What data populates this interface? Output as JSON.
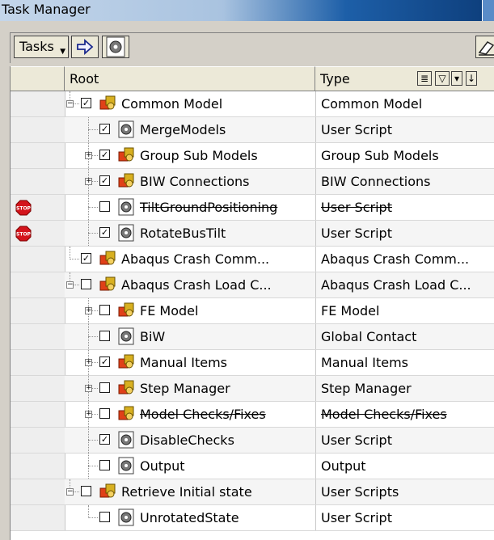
{
  "window": {
    "title": "Task Manager"
  },
  "toolbar": {
    "tasks_label": "Tasks"
  },
  "columns": {
    "root": "Root",
    "type": "Type"
  },
  "colors": {
    "stop": "#d4141c",
    "folder": "#e04018",
    "accent": "#1d5fa8"
  },
  "rows": [
    {
      "label": "Common Model",
      "type": "Common Model",
      "level": 0,
      "expander": "minus",
      "checked": true,
      "icon": "model-folder-icon",
      "strike": false,
      "stop": false
    },
    {
      "label": "MergeModels",
      "type": "User Script",
      "level": 1,
      "expander": "none",
      "checked": true,
      "icon": "script-gear-icon",
      "strike": false,
      "stop": false
    },
    {
      "label": "Group Sub Models",
      "type": "Group Sub Models",
      "level": 1,
      "expander": "plus",
      "checked": true,
      "icon": "model-folder-icon",
      "strike": false,
      "stop": false
    },
    {
      "label": "BIW Connections",
      "type": "BIW Connections",
      "level": 1,
      "expander": "plus",
      "checked": true,
      "icon": "model-folder-icon",
      "strike": false,
      "stop": false
    },
    {
      "label": "TiltGroundPositioning",
      "type": "User Script",
      "level": 1,
      "expander": "none",
      "checked": false,
      "icon": "script-gear-icon",
      "strike": true,
      "stop": true
    },
    {
      "label": "RotateBusTilt",
      "type": "User Script",
      "level": 1,
      "expander": "none",
      "checked": true,
      "icon": "script-gear-icon",
      "strike": false,
      "stop": true
    },
    {
      "label": "Abaqus Crash Comm...",
      "type": "Abaqus Crash Comm...",
      "level": 0,
      "expander": "none",
      "checked": true,
      "icon": "model-folder-icon",
      "strike": false,
      "stop": false
    },
    {
      "label": "Abaqus Crash Load C...",
      "type": "Abaqus Crash Load C...",
      "level": 0,
      "expander": "minus",
      "checked": false,
      "icon": "model-folder-icon",
      "strike": false,
      "stop": false
    },
    {
      "label": "FE Model",
      "type": "FE Model",
      "level": 1,
      "expander": "plus",
      "checked": false,
      "icon": "model-folder-icon",
      "strike": false,
      "stop": false
    },
    {
      "label": "BiW",
      "type": "Global Contact",
      "level": 1,
      "expander": "none",
      "checked": false,
      "icon": "script-gear-icon",
      "strike": false,
      "stop": false
    },
    {
      "label": "Manual Items",
      "type": "Manual Items",
      "level": 1,
      "expander": "plus",
      "checked": true,
      "icon": "model-folder-icon",
      "strike": false,
      "stop": false
    },
    {
      "label": "Step Manager",
      "type": "Step Manager",
      "level": 1,
      "expander": "plus",
      "checked": false,
      "icon": "model-folder-icon",
      "strike": false,
      "stop": false
    },
    {
      "label": "Model Checks/Fixes",
      "type": "Model Checks/Fixes",
      "level": 1,
      "expander": "plus",
      "checked": false,
      "icon": "model-folder-icon",
      "strike": true,
      "stop": false
    },
    {
      "label": "DisableChecks",
      "type": "User Script",
      "level": 1,
      "expander": "none",
      "checked": true,
      "icon": "script-gear-icon",
      "strike": false,
      "stop": false
    },
    {
      "label": "Output",
      "type": "Output",
      "level": 1,
      "expander": "none",
      "checked": false,
      "icon": "script-gear-icon",
      "strike": false,
      "stop": false
    },
    {
      "label": "Retrieve Initial state",
      "type": "User Scripts",
      "level": 0,
      "expander": "minus",
      "checked": false,
      "icon": "model-folder-icon",
      "strike": false,
      "stop": false
    },
    {
      "label": "UnrotatedState",
      "type": "User Script",
      "level": 1,
      "expander": "none",
      "checked": false,
      "icon": "script-gear-icon",
      "strike": false,
      "stop": false
    }
  ]
}
